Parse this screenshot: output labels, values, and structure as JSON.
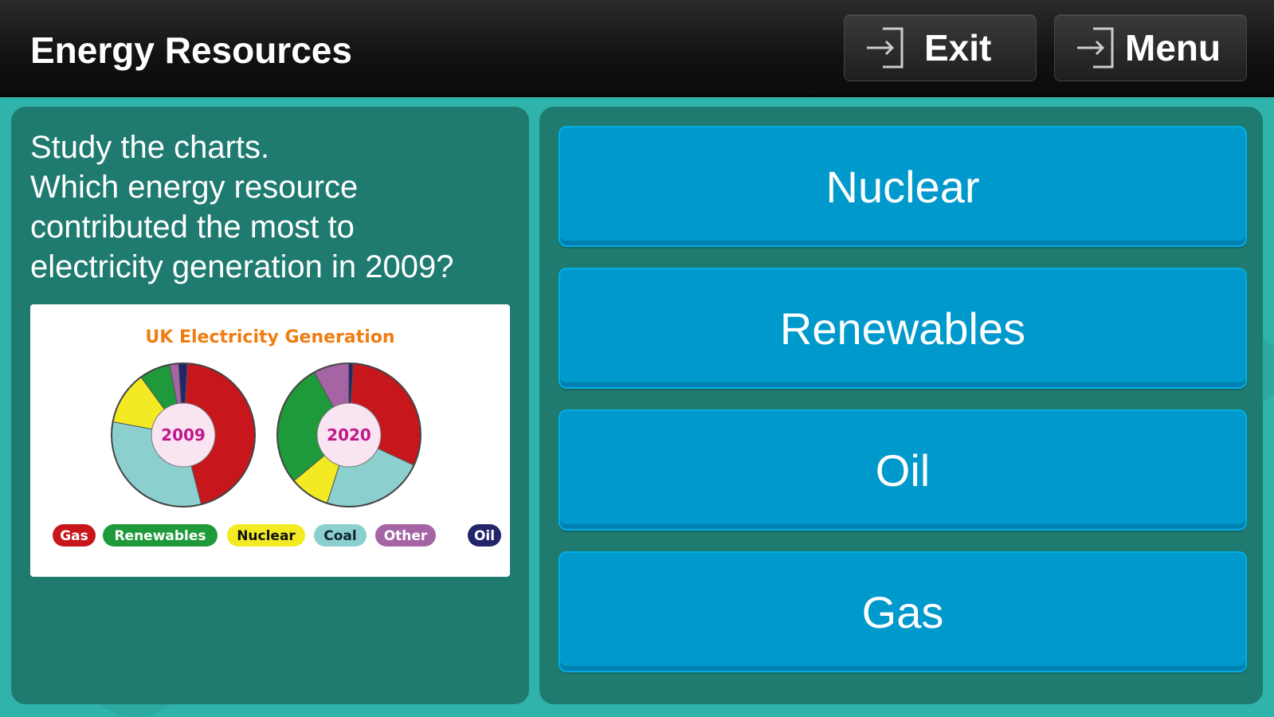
{
  "header": {
    "title": "Energy Resources",
    "exit_label": "Exit",
    "menu_label": "Menu",
    "exit_icon": "exit-arrow-icon",
    "menu_icon": "exit-arrow-icon"
  },
  "question": {
    "lines": [
      "Study the charts.",
      "Which energy resource",
      "contributed the most to",
      "electricity generation in 2009?"
    ]
  },
  "answers": [
    "Nuclear",
    "Renewables",
    "Oil",
    "Gas"
  ],
  "colors": {
    "Gas": "#c8171c",
    "Renewables": "#1f9a3a",
    "Nuclear": "#f4ea24",
    "Coal": "#8ccfcf",
    "Other": "#a565a5",
    "Oil": "#23256b",
    "title": "#f07d12",
    "center_label": "#c0188c",
    "center_fill": "#f9e4f2"
  },
  "chart_data": {
    "type": "pie",
    "title": "UK Electricity Generation",
    "legend": [
      "Gas",
      "Renewables",
      "Nuclear",
      "Coal",
      "Other",
      "Oil"
    ],
    "legend_placement": "bottom",
    "charts": [
      {
        "label": "2009",
        "slices": [
          {
            "name": "Gas",
            "value": 45
          },
          {
            "name": "Coal",
            "value": 32
          },
          {
            "name": "Nuclear",
            "value": 12
          },
          {
            "name": "Renewables",
            "value": 7
          },
          {
            "name": "Other",
            "value": 2
          },
          {
            "name": "Oil",
            "value": 2
          }
        ]
      },
      {
        "label": "2020",
        "slices": [
          {
            "name": "Gas",
            "value": 31
          },
          {
            "name": "Coal",
            "value": 23
          },
          {
            "name": "Nuclear",
            "value": 9
          },
          {
            "name": "Renewables",
            "value": 28
          },
          {
            "name": "Other",
            "value": 8
          },
          {
            "name": "Oil",
            "value": 1
          }
        ]
      }
    ]
  }
}
